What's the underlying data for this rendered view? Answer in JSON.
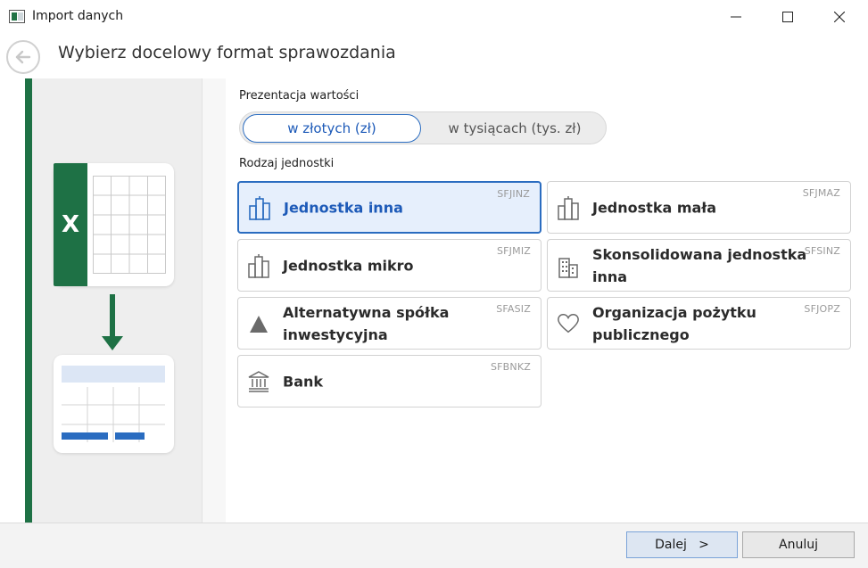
{
  "window": {
    "title": "Import danych"
  },
  "header": {
    "title": "Wybierz docelowy format sprawozdania"
  },
  "illustration": {
    "excel_letter": "X"
  },
  "presentation": {
    "label": "Prezentacja wartości",
    "options": [
      {
        "label": "w złotych (zł)",
        "selected": true
      },
      {
        "label": "w tysiącach (tys. zł)",
        "selected": false
      }
    ]
  },
  "unit_type": {
    "label": "Rodzaj jednostki",
    "options": [
      {
        "label": "Jednostka inna",
        "code": "SFJINZ",
        "icon": "buildings-icon",
        "selected": true
      },
      {
        "label": "Jednostka mała",
        "code": "SFJMAZ",
        "icon": "buildings-icon",
        "selected": false
      },
      {
        "label": "Jednostka mikro",
        "code": "SFJMIZ",
        "icon": "buildings-icon",
        "selected": false
      },
      {
        "label": "Skonsolidowana jednostka inna",
        "code": "SFSINZ",
        "icon": "city-icon",
        "selected": false
      },
      {
        "label": "Alternatywna spółka inwestycyjna",
        "code": "SFASIZ",
        "icon": "triangle-icon",
        "selected": false
      },
      {
        "label": "Organizacja pożytku publicznego",
        "code": "SFJOPZ",
        "icon": "heart-icon",
        "selected": false
      },
      {
        "label": "Bank",
        "code": "SFBNKZ",
        "icon": "bank-icon",
        "selected": false
      }
    ]
  },
  "footer": {
    "next_label": "Dalej   >",
    "cancel_label": "Anuluj"
  },
  "colors": {
    "accent": "#2a6cc0",
    "excel_green": "#1e7145",
    "selected_bg": "#e6effc"
  }
}
